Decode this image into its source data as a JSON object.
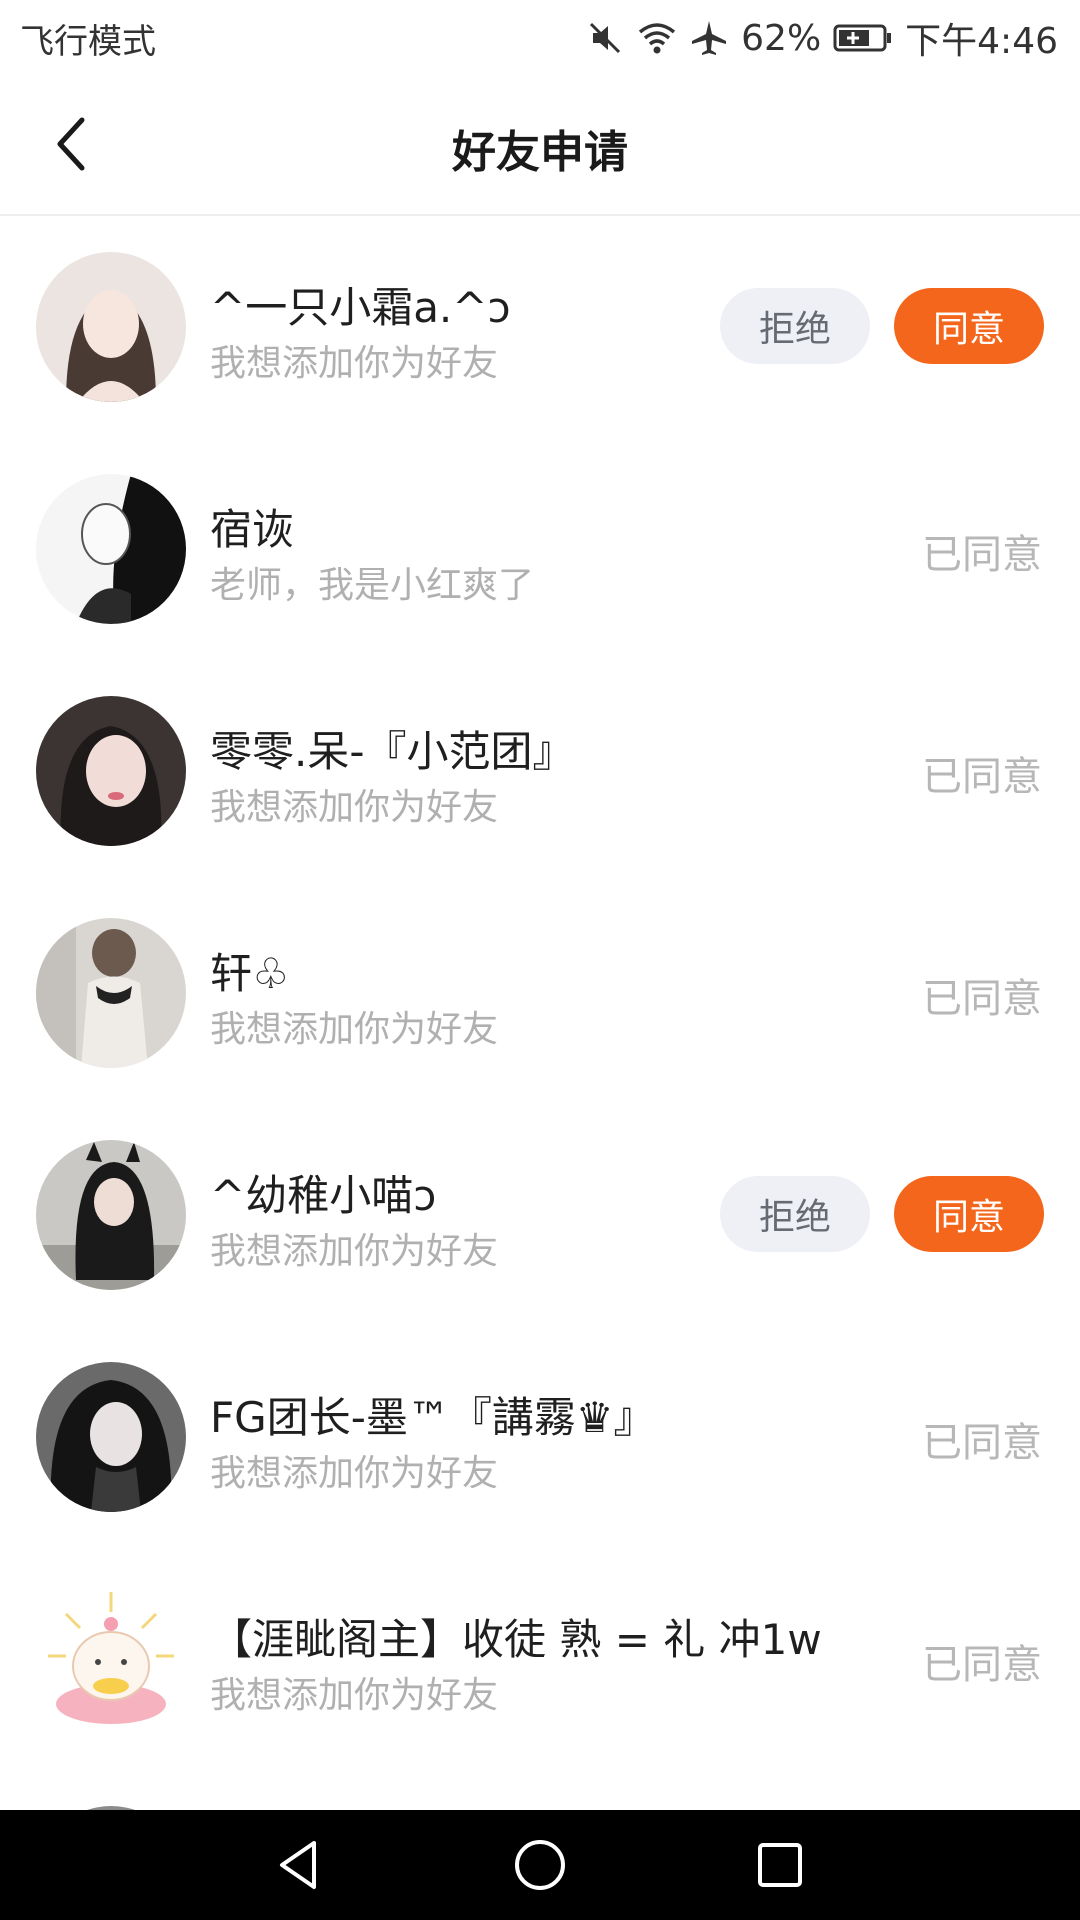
{
  "status_bar": {
    "mode_text": "飞行模式",
    "battery_percent": "62%",
    "time": "下午4:46",
    "icons": [
      "mute-icon",
      "wifi-icon",
      "airplane-icon",
      "battery-charging-icon"
    ]
  },
  "header": {
    "title": "好友申请",
    "back_icon": "chevron-left-icon"
  },
  "labels": {
    "reject": "拒绝",
    "accept": "同意",
    "accepted": "已同意"
  },
  "colors": {
    "accent": "#f4661b",
    "reject_bg": "#eef0f5",
    "muted_text": "#b0b0b0"
  },
  "requests": [
    {
      "name": "^一只小霜a.^ↄ",
      "message": "我想添加你为好友",
      "status": "pending"
    },
    {
      "name": "宿诙",
      "message": "老师，我是小红爽了",
      "status": "accepted"
    },
    {
      "name": "零零.呆-『小范团』",
      "message": "我想添加你为好友",
      "status": "accepted"
    },
    {
      "name": "轩♧",
      "message": "我想添加你为好友",
      "status": "accepted"
    },
    {
      "name": "^幼稚小喵ↄ",
      "message": "我想添加你为好友",
      "status": "pending"
    },
    {
      "name": "FG团长-墨™『講霧♛』",
      "message": "我想添加你为好友",
      "status": "accepted"
    },
    {
      "name": "【涯眦阁主】收徒 熟 = 礼 冲1w",
      "message": "我想添加你为好友",
      "status": "accepted"
    }
  ],
  "nav_bar": {
    "icons": [
      "back-triangle-icon",
      "home-circle-icon",
      "recents-square-icon"
    ]
  }
}
